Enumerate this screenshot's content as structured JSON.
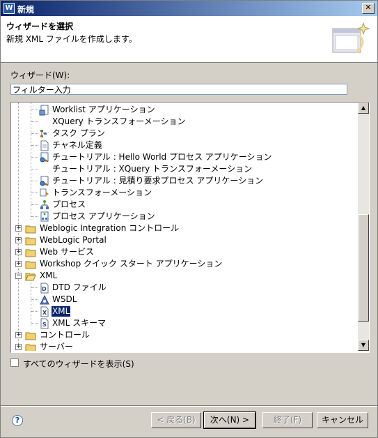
{
  "window": {
    "title": "新規"
  },
  "header": {
    "title": "ウィザードを選択",
    "description": "新規 XML ファイルを作成します。"
  },
  "wizards_label": "ウィザード(W):",
  "filter": {
    "value": "フィルター入力"
  },
  "tree": {
    "items": [
      {
        "label": "Worklist アプリケーション",
        "icon": "app-doc-icon"
      },
      {
        "label": "XQuery トランスフォーメーション",
        "icon": "none"
      },
      {
        "label": "タスク プラン",
        "icon": "task-plan-icon"
      },
      {
        "label": "チャネル定義",
        "icon": "doc-icon"
      },
      {
        "label": "チュートリアル : Hello World プロセス アプリケーション",
        "icon": "tutorial-icon"
      },
      {
        "label": "チュートリアル : XQuery トランスフォーメーション",
        "icon": "none"
      },
      {
        "label": "チュートリアル : 見積り要求プロセス アプリケーション",
        "icon": "tutorial-icon"
      },
      {
        "label": "トランスフォーメーション",
        "icon": "transform-icon"
      },
      {
        "label": "プロセス",
        "icon": "process-icon"
      },
      {
        "label": "プロセス アプリケーション",
        "icon": "process-app-icon"
      },
      {
        "label": "Weblogic Integration コントロール",
        "icon": "folder-icon"
      },
      {
        "label": "WebLogic Portal",
        "icon": "folder-icon"
      },
      {
        "label": "Web サービス",
        "icon": "folder-icon"
      },
      {
        "label": "Workshop クイック スタート アプリケーション",
        "icon": "folder-icon"
      },
      {
        "label": "XML",
        "icon": "folder-open-icon"
      },
      {
        "label": "DTD ファイル",
        "icon": "dtd-icon"
      },
      {
        "label": "WSDL",
        "icon": "wsdl-icon"
      },
      {
        "label": "XML",
        "icon": "xml-icon"
      },
      {
        "label": "XML スキーマ",
        "icon": "schema-icon"
      },
      {
        "label": "コントロール",
        "icon": "folder-icon"
      },
      {
        "label": "サーバー",
        "icon": "folder-icon"
      }
    ]
  },
  "show_all": {
    "label": "すべてのウィザードを表示(S)",
    "checked": false
  },
  "buttons": {
    "back": "< 戻る(B)",
    "next": "次へ(N) >",
    "finish": "終了(F)",
    "cancel": "キャンセル"
  }
}
